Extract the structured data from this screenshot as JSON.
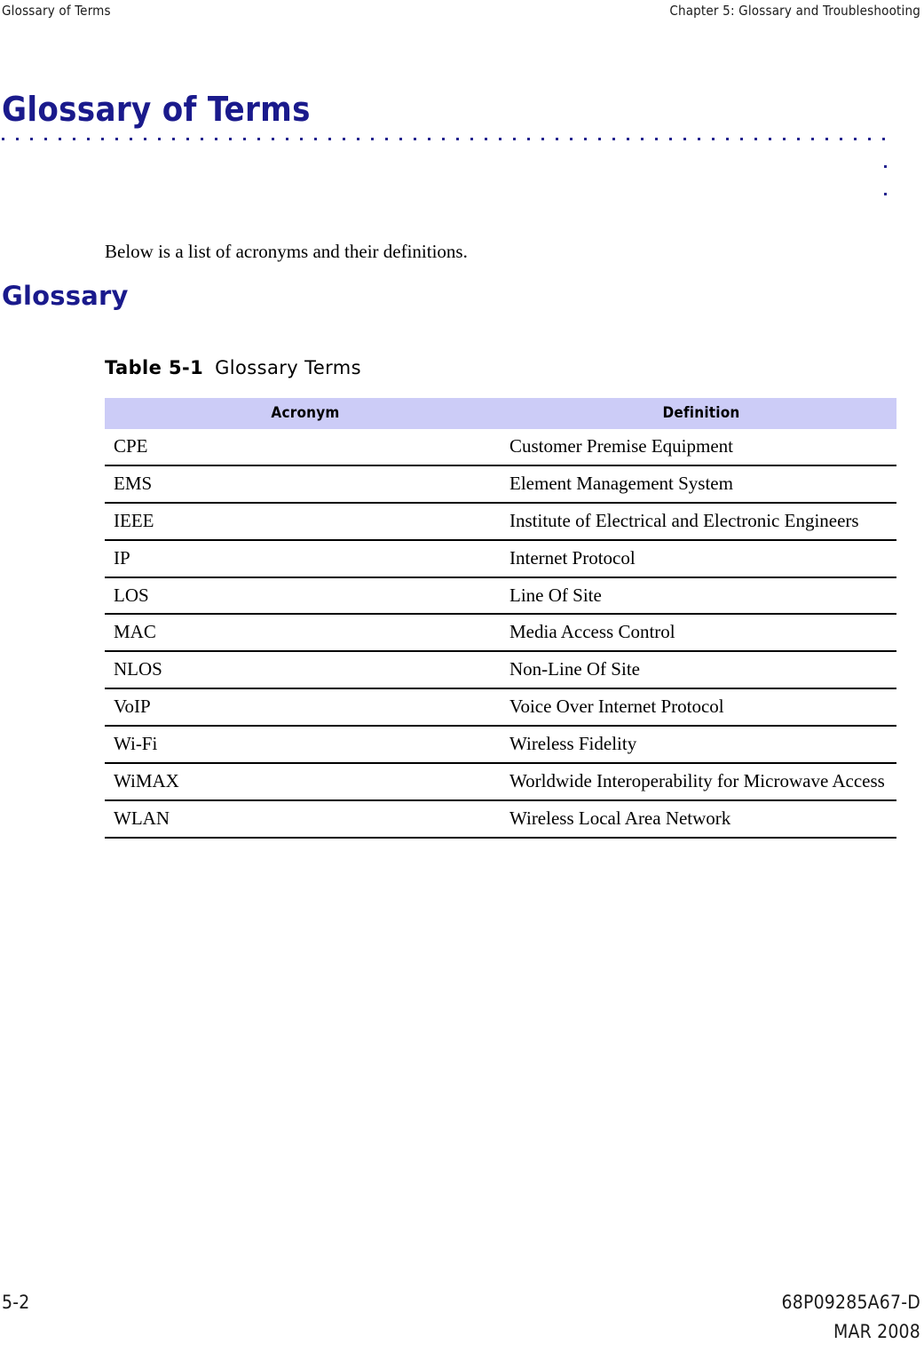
{
  "header": {
    "left": "Glossary of Terms",
    "right": "Chapter 5:  Glossary and Troubleshooting"
  },
  "title": {
    "text": "Glossary of Terms",
    "color": "#1a1a8c",
    "rule_color": "#26268f"
  },
  "intro": {
    "paragraph": "Below is a list of acronyms and their definitions."
  },
  "section": {
    "heading": "Glossary"
  },
  "table": {
    "caption_label": "Table 5-1",
    "caption_title": "Glossary Terms",
    "header_background": "#ccccf7",
    "columns": [
      "Acronym",
      "Definition"
    ],
    "rows": [
      {
        "acronym": "CPE",
        "definition": "Customer Premise Equipment"
      },
      {
        "acronym": "EMS",
        "definition": "Element Management System"
      },
      {
        "acronym": "IEEE",
        "definition": "Institute of Electrical and Electronic Engineers"
      },
      {
        "acronym": "IP",
        "definition": "Internet Protocol"
      },
      {
        "acronym": "LOS",
        "definition": "Line Of Site"
      },
      {
        "acronym": "MAC",
        "definition": "Media Access Control"
      },
      {
        "acronym": "NLOS",
        "definition": "Non-Line Of Site"
      },
      {
        "acronym": "VoIP",
        "definition": "Voice Over Internet Protocol"
      },
      {
        "acronym": "Wi-Fi",
        "definition": "Wireless Fidelity"
      },
      {
        "acronym": "WiMAX",
        "definition": "Worldwide Interoperability for Microwave Access"
      },
      {
        "acronym": "WLAN",
        "definition": "Wireless Local Area Network"
      }
    ]
  },
  "footer": {
    "page_number": "5-2",
    "doc_number": "68P09285A67-D",
    "date": "MAR 2008"
  }
}
